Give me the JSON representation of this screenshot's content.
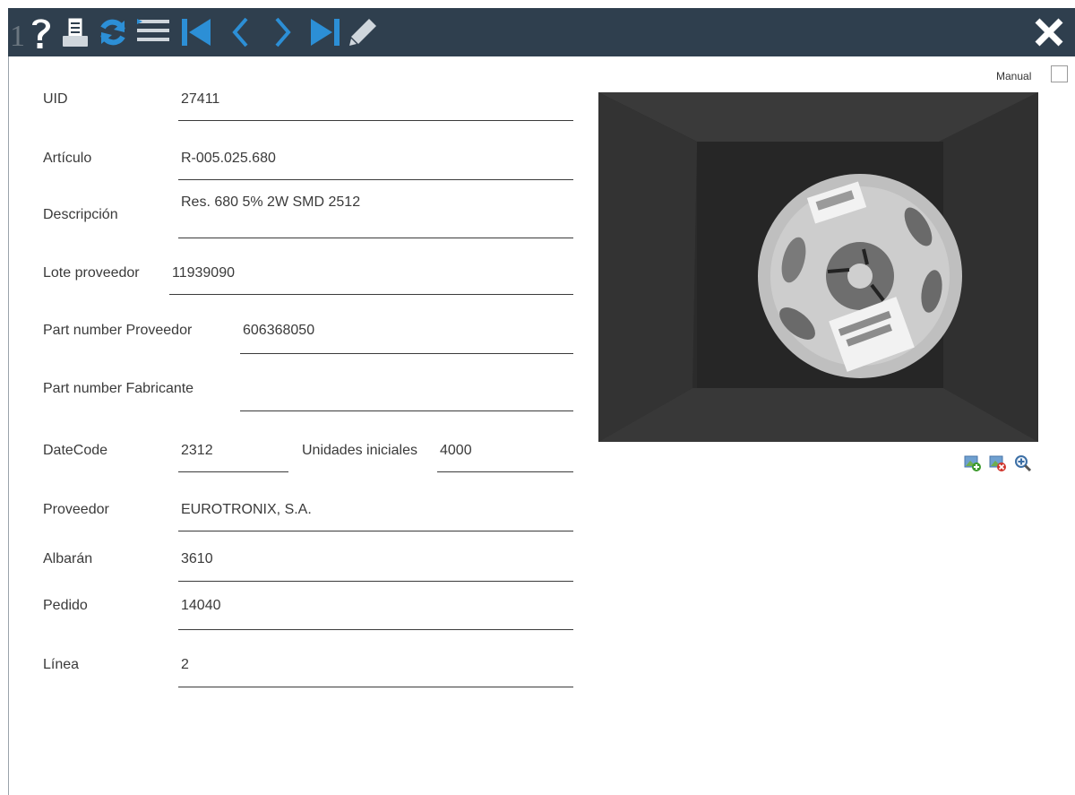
{
  "toolbar": {
    "row_number": "1",
    "icons": [
      "help-icon",
      "print-icon",
      "refresh-icon",
      "list-icon",
      "first-record-icon",
      "previous-icon",
      "next-icon",
      "last-record-icon",
      "edit-icon",
      "close-icon"
    ]
  },
  "form": {
    "uid": {
      "label": "UID",
      "value": "27411"
    },
    "articulo": {
      "label": "Artículo",
      "value": "R-005.025.680"
    },
    "descripcion": {
      "label": "Descripción",
      "value": "Res. 680 5% 2W SMD 2512"
    },
    "lote_proveedor": {
      "label": "Lote proveedor",
      "value": "11939090"
    },
    "pn_proveedor": {
      "label": "Part number Proveedor",
      "value": "606368050"
    },
    "pn_fabricante": {
      "label": "Part number Fabricante",
      "value": ""
    },
    "datecode": {
      "label": "DateCode",
      "value": "2312"
    },
    "unidades_iniciales": {
      "label": "Unidades iniciales",
      "value": "4000"
    },
    "proveedor": {
      "label": "Proveedor",
      "value": "EUROTRONIX, S.A."
    },
    "albaran": {
      "label": "Albarán",
      "value": "3610"
    },
    "pedido": {
      "label": "Pedido",
      "value": "14040"
    },
    "linea": {
      "label": "Línea",
      "value": "2"
    }
  },
  "image_panel": {
    "manual_label": "Manual",
    "manual_checked": false,
    "buttons": [
      "add-image-icon",
      "delete-image-icon",
      "zoom-in-icon"
    ]
  },
  "colors": {
    "toolbar_bg": "#2f3f4e",
    "accent_blue": "#2c8fd6",
    "icon_light": "#cfd6dc"
  }
}
